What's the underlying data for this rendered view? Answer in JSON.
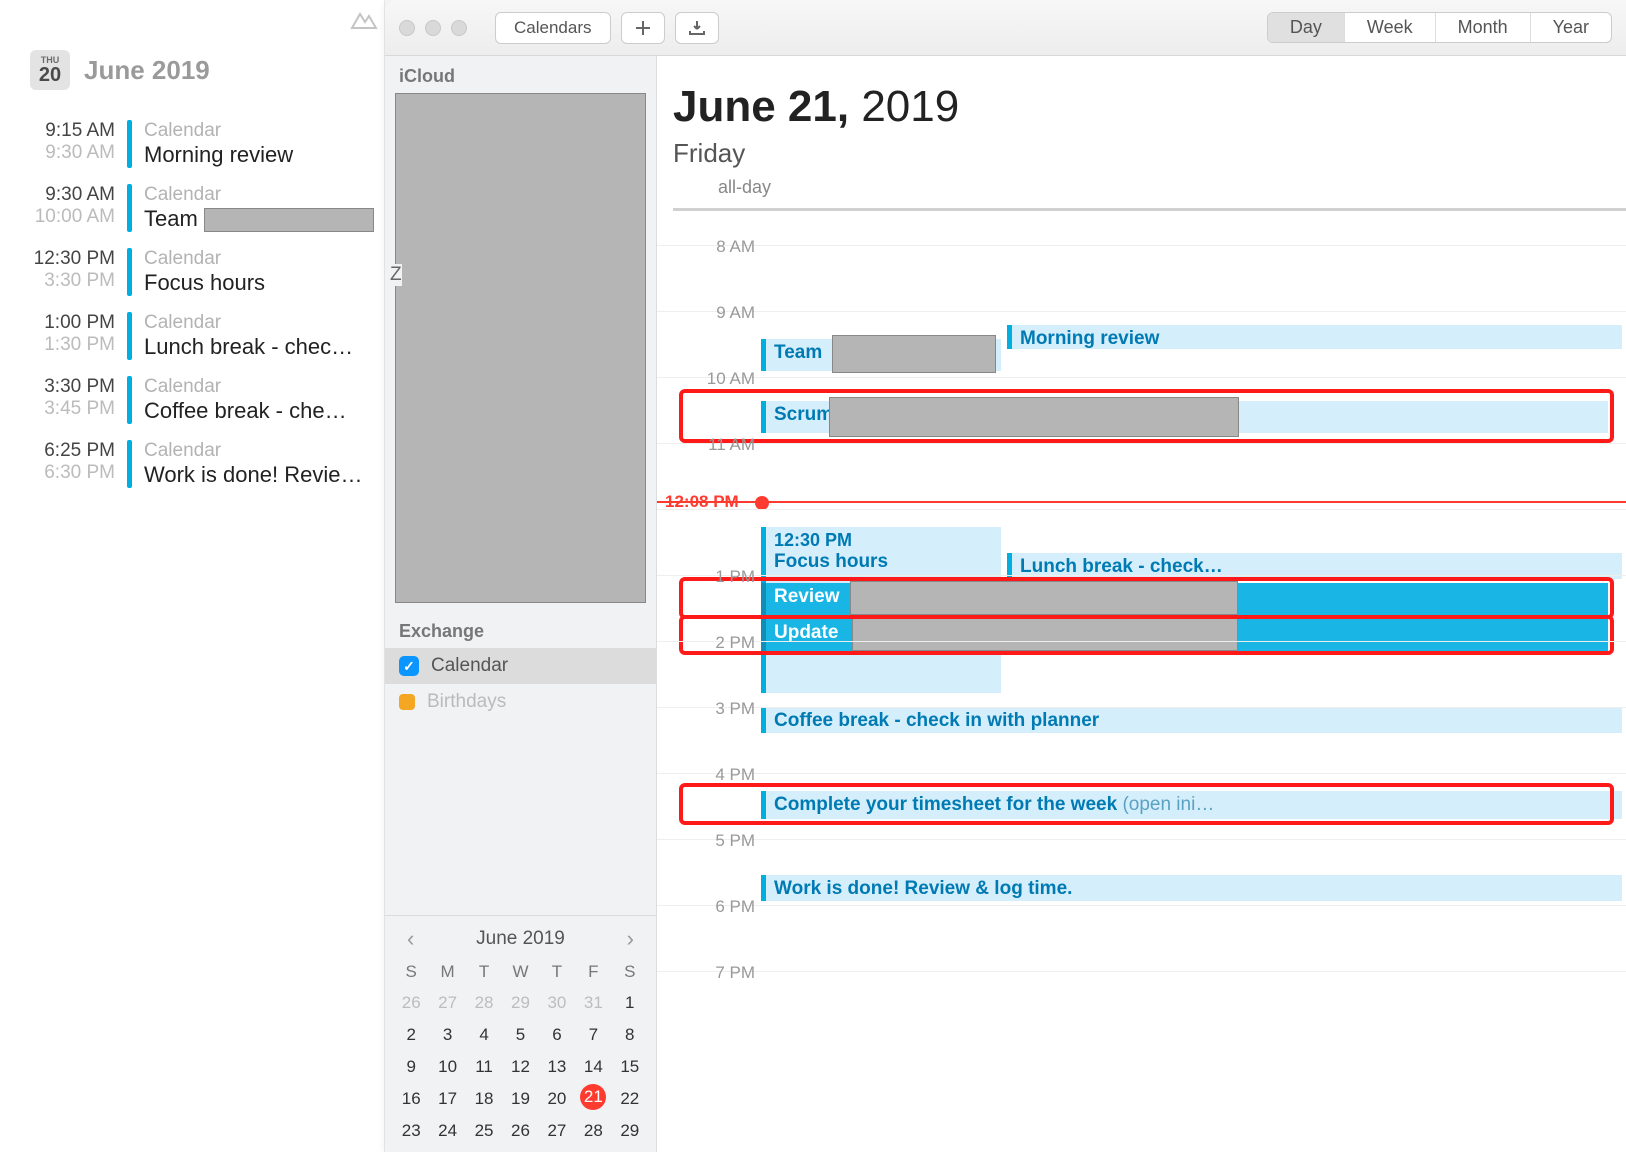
{
  "today": {
    "icon_dow": "THU",
    "icon_num": "20",
    "title": "June 2019",
    "items": [
      {
        "start": "9:15 AM",
        "end": "9:30 AM",
        "label": "Calendar",
        "title": "Morning review",
        "redacted": false
      },
      {
        "start": "9:30 AM",
        "end": "10:00 AM",
        "label": "Calendar",
        "title": "Team ",
        "redacted": true
      },
      {
        "start": "12:30 PM",
        "end": "3:30 PM",
        "label": "Calendar",
        "title": "Focus hours",
        "redacted": false
      },
      {
        "start": "1:00 PM",
        "end": "1:30 PM",
        "label": "Calendar",
        "title": "Lunch break - chec…",
        "redacted": false
      },
      {
        "start": "3:30 PM",
        "end": "3:45 PM",
        "label": "Calendar",
        "title": "Coffee break - che…",
        "redacted": false
      },
      {
        "start": "6:25 PM",
        "end": "6:30 PM",
        "label": "Calendar",
        "title": "Work is done! Revie…",
        "redacted": false
      }
    ]
  },
  "toolbar": {
    "calendars": "Calendars",
    "views": {
      "day": "Day",
      "week": "Week",
      "month": "Month",
      "year": "Year"
    },
    "active_view": "day"
  },
  "sidebar": {
    "sections": {
      "icloud": "iCloud",
      "exchange": "Exchange"
    },
    "z_label": "Z",
    "exchange_rows": [
      {
        "name": "Calendar",
        "checked": true,
        "selected": true
      },
      {
        "name": "Birthdays",
        "checked": false,
        "selected": false,
        "muted": true
      }
    ]
  },
  "mini": {
    "title": "June 2019",
    "dows": [
      "S",
      "M",
      "T",
      "W",
      "T",
      "F",
      "S"
    ],
    "days": [
      {
        "n": "26",
        "m": true
      },
      {
        "n": "27",
        "m": true
      },
      {
        "n": "28",
        "m": true
      },
      {
        "n": "29",
        "m": true
      },
      {
        "n": "30",
        "m": true
      },
      {
        "n": "31",
        "m": true
      },
      {
        "n": "1"
      },
      {
        "n": "2"
      },
      {
        "n": "3"
      },
      {
        "n": "4"
      },
      {
        "n": "5"
      },
      {
        "n": "6"
      },
      {
        "n": "7"
      },
      {
        "n": "8"
      },
      {
        "n": "9"
      },
      {
        "n": "10"
      },
      {
        "n": "11"
      },
      {
        "n": "12"
      },
      {
        "n": "13"
      },
      {
        "n": "14"
      },
      {
        "n": "15"
      },
      {
        "n": "16"
      },
      {
        "n": "17"
      },
      {
        "n": "18"
      },
      {
        "n": "19"
      },
      {
        "n": "20"
      },
      {
        "n": "21",
        "today": true
      },
      {
        "n": "22"
      },
      {
        "n": "23"
      },
      {
        "n": "24"
      },
      {
        "n": "25"
      },
      {
        "n": "26"
      },
      {
        "n": "27"
      },
      {
        "n": "28"
      },
      {
        "n": "29"
      }
    ]
  },
  "day": {
    "month_day": "June 21,",
    "year": "2019",
    "dow": "Friday",
    "allday_label": "all-day",
    "now_label": "12:08 PM",
    "hours": [
      "8 AM",
      "9 AM",
      "10 AM",
      "11 AM",
      "",
      "1 PM",
      "2 PM",
      "3 PM",
      "4 PM",
      "5 PM",
      "6 PM",
      "7 PM"
    ],
    "events": {
      "morning_review": "Morning review",
      "team": "Team ",
      "scrum": "Scrum",
      "focus_time": "12:30 PM",
      "focus_title": "Focus hours",
      "lunch": "Lunch break - check…",
      "review": "Review",
      "update": "Update",
      "coffee": "Coffee break - check in with planner",
      "timesheet": "Complete your timesheet for the week",
      "timesheet_note": "(open ini…",
      "done": "Work is done! Review & log time."
    }
  }
}
